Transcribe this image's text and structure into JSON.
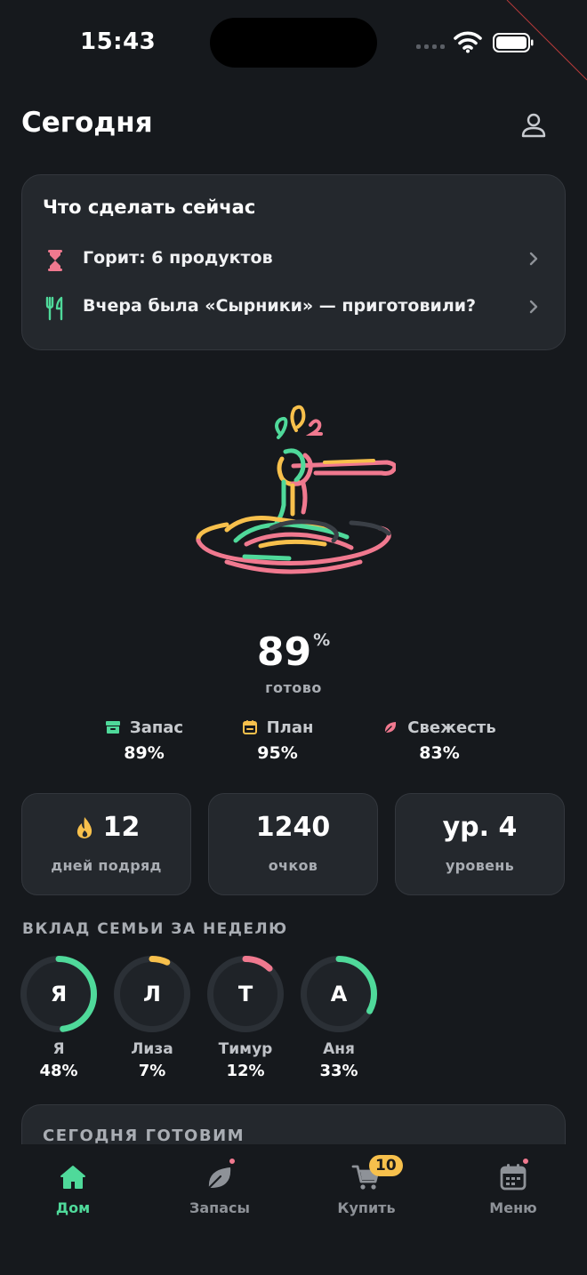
{
  "status": {
    "time": "15:43"
  },
  "header": {
    "title": "Сегодня"
  },
  "todo": {
    "title": "Что сделать сейчас",
    "items": [
      {
        "icon": "hourglass-icon",
        "text": "Горит: 6 продуктов"
      },
      {
        "icon": "fork-knife-icon",
        "text": "Вчера была «Сырники» — приготовили?"
      }
    ]
  },
  "readiness": {
    "value": "89",
    "unit": "%",
    "label": "готово",
    "metrics": [
      {
        "icon": "archive-icon",
        "label": "Запас",
        "value": "89%"
      },
      {
        "icon": "calendar-icon",
        "label": "План",
        "value": "95%"
      },
      {
        "icon": "leaf-icon",
        "label": "Свежесть",
        "value": "83%"
      }
    ]
  },
  "stats": [
    {
      "icon": "flame-icon",
      "value": "12",
      "caption": "дней подряд"
    },
    {
      "value": "1240",
      "caption": "очков"
    },
    {
      "value": "ур. 4",
      "caption": "уровень"
    }
  ],
  "family": {
    "title": "ВКЛАД СЕМЬИ ЗА НЕДЕЛЮ",
    "members": [
      {
        "initial": "Я",
        "name": "Я",
        "pct": "48%",
        "fraction": 0.48,
        "color": "#4fd99a"
      },
      {
        "initial": "Л",
        "name": "Лиза",
        "pct": "7%",
        "fraction": 0.07,
        "color": "#f7c04c"
      },
      {
        "initial": "Т",
        "name": "Тимур",
        "pct": "12%",
        "fraction": 0.12,
        "color": "#f0798f"
      },
      {
        "initial": "А",
        "name": "Аня",
        "pct": "33%",
        "fraction": 0.33,
        "color": "#4fd99a"
      }
    ]
  },
  "cooking": {
    "title": "СЕГОДНЯ ГОТОВИМ"
  },
  "tabs": [
    {
      "label": "Дом",
      "icon": "home-icon",
      "active": true
    },
    {
      "label": "Запасы",
      "icon": "leaf-icon",
      "dot": true
    },
    {
      "label": "Купить",
      "icon": "cart-icon",
      "badge": "10"
    },
    {
      "label": "Меню",
      "icon": "calendar-icon",
      "dot": true
    }
  ],
  "colors": {
    "accent_green": "#4fd99a",
    "accent_yellow": "#f7c04c",
    "accent_pink": "#f0798f",
    "background": "#16191d",
    "card": "#24282d"
  }
}
